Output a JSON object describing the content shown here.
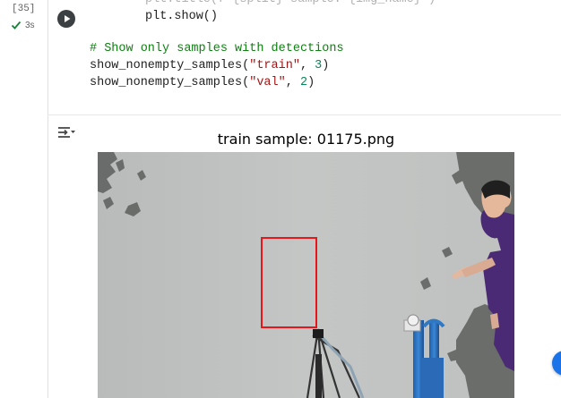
{
  "cell": {
    "execution_count": "[35]",
    "exec_time": "3s",
    "code_lines": [
      {
        "tokens": [
          {
            "t": "plt.title(f\"{split} sample: {img_name}\")",
            "cls": "c-faded"
          }
        ]
      },
      {
        "tokens": [
          {
            "t": "plt.show()",
            "cls": ""
          }
        ]
      },
      {
        "tokens": [
          {
            "t": "",
            "cls": ""
          }
        ]
      },
      {
        "tokens": [
          {
            "t": "# Show only samples with detections",
            "cls": "c-comment"
          }
        ]
      },
      {
        "tokens": [
          {
            "t": "show_nonempty_samples(",
            "cls": ""
          },
          {
            "t": "\"train\"",
            "cls": "c-string"
          },
          {
            "t": ", ",
            "cls": ""
          },
          {
            "t": "3",
            "cls": "c-num"
          },
          {
            "t": ")",
            "cls": ""
          }
        ]
      },
      {
        "tokens": [
          {
            "t": "show_nonempty_samples(",
            "cls": ""
          },
          {
            "t": "\"val\"",
            "cls": "c-string"
          },
          {
            "t": ", ",
            "cls": ""
          },
          {
            "t": "2",
            "cls": "c-num"
          },
          {
            "t": ")",
            "cls": ""
          }
        ]
      }
    ]
  },
  "output": {
    "plot_title": "train sample: 01175.png"
  },
  "colors": {
    "accent": "#1a73e8",
    "check": "#188038",
    "bbox": "#e8161b"
  },
  "icons": {
    "run": "play-icon",
    "status": "check-icon",
    "output_toggle": "output-menu-icon"
  }
}
